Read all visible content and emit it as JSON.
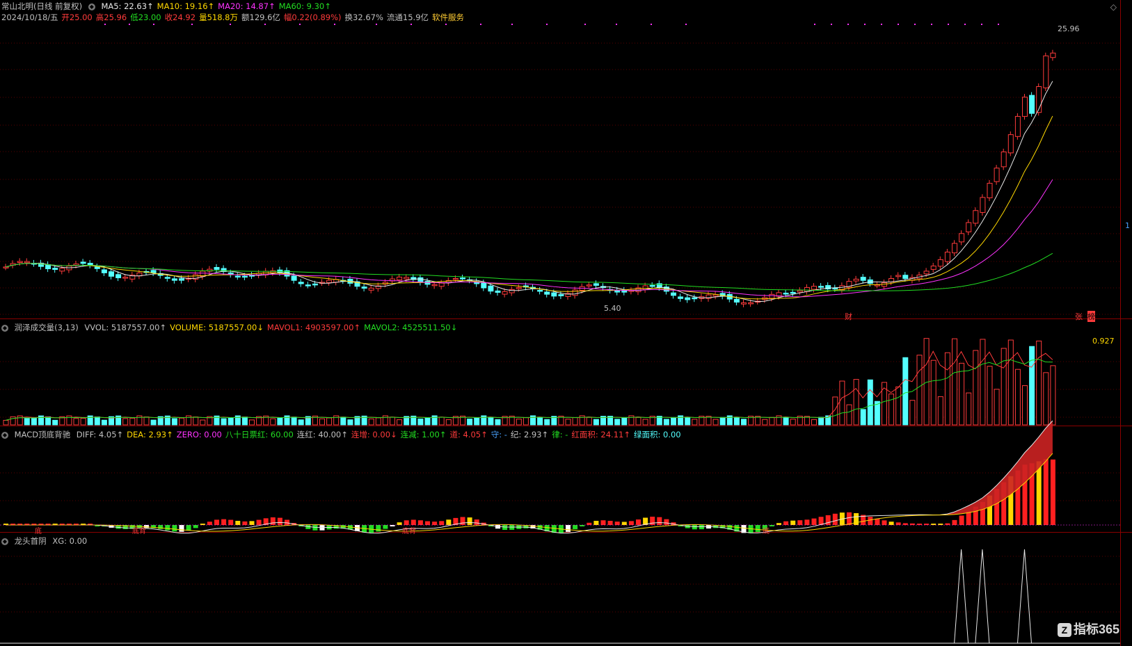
{
  "main": {
    "stock_name": "常山北明(日线 前复权)",
    "ma_labels": [
      {
        "text": "MA5: 22.63↑",
        "color": "#e8e8e8"
      },
      {
        "text": "MA10: 19.16↑",
        "color": "#ffd800"
      },
      {
        "text": "MA20: 14.87↑",
        "color": "#ff33ff"
      },
      {
        "text": "MA60: 9.30↑",
        "color": "#22dd22"
      }
    ],
    "date": "2024/10/18/五",
    "quote": [
      {
        "text": "开25.00",
        "color": "#ff3b3b"
      },
      {
        "text": "高25.96",
        "color": "#ff3b3b"
      },
      {
        "text": "低23.00",
        "color": "#22dd22"
      },
      {
        "text": "收24.92",
        "color": "#ff3b3b"
      },
      {
        "text": "量518.8万",
        "color": "#ffd800"
      },
      {
        "text": "额129.6亿",
        "color": "#c0c0c0"
      },
      {
        "text": "幅0.22(0.89%)",
        "color": "#ff3b3b"
      },
      {
        "text": "换32.67%",
        "color": "#c0c0c0"
      },
      {
        "text": "流通15.9亿",
        "color": "#c0c0c0"
      },
      {
        "text": "软件服务",
        "color": "#ffcc33"
      }
    ],
    "high_label": "25.96",
    "low_label": "5.40",
    "event_labels": {
      "cai": "财",
      "zhang": "张",
      "bang": "榜"
    },
    "right_marker": "1"
  },
  "volume": {
    "title": "润泽成交量(3,13)",
    "items": [
      {
        "text": "VVOL: 5187557.00↑",
        "color": "#c0c0c0"
      },
      {
        "text": "VOLUME: 5187557.00↓",
        "color": "#ffd800"
      },
      {
        "text": "MAVOL1: 4903597.00↑",
        "color": "#ff3b3b"
      },
      {
        "text": "MAVOL2: 4525511.50↓",
        "color": "#22dd22"
      }
    ],
    "max_label": "0.927"
  },
  "macd": {
    "title": "MACD顶底背驰",
    "items": [
      {
        "text": "DIFF: 4.05↑",
        "color": "#c0c0c0"
      },
      {
        "text": "DEA: 2.93↑",
        "color": "#ffd800"
      },
      {
        "text": "ZERO: 0.00",
        "color": "#ff33ff"
      },
      {
        "text": "八十日票红: 60.00",
        "color": "#22dd22"
      },
      {
        "text": "连红: 40.00↑",
        "color": "#c0c0c0"
      },
      {
        "text": "连增: 0.00↓",
        "color": "#ff3b3b"
      },
      {
        "text": "连减: 1.00↑",
        "color": "#22dd22"
      },
      {
        "text": "道: 4.05↑",
        "color": "#ff3b3b"
      },
      {
        "text": "守: -",
        "color": "#4aa3ff"
      },
      {
        "text": "纪: 2.93↑",
        "color": "#c0c0c0"
      },
      {
        "text": "律: -",
        "color": "#22dd22"
      },
      {
        "text": "红面积: 24.11↑",
        "color": "#ff3b3b"
      },
      {
        "text": "绿面积: 0.00",
        "color": "#54ffff"
      }
    ],
    "divergence_labels": {
      "first": "底",
      "second": "底背",
      "third": "底背",
      "fourth": "底"
    }
  },
  "leader": {
    "title": "龙头首阴",
    "value": "XG: 0.00"
  },
  "brand": {
    "logo": "Z",
    "text": "指标365"
  },
  "toggle_icon": "◇"
}
